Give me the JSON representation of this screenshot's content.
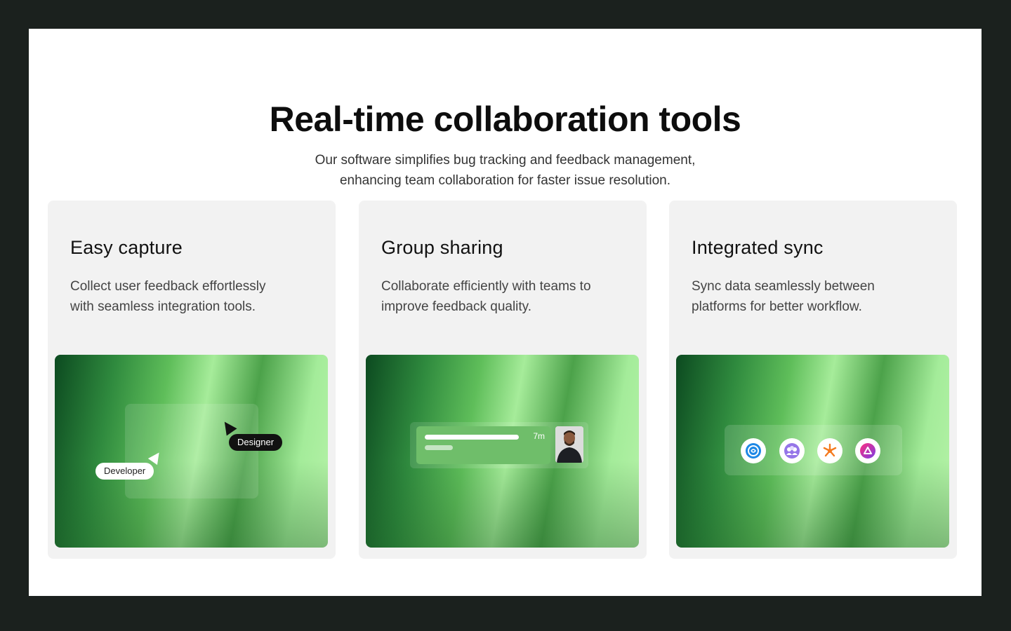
{
  "header": {
    "title": "Real-time collaboration tools",
    "subtitle_line1": "Our software simplifies bug tracking and feedback management,",
    "subtitle_line2": "enhancing team collaboration for faster issue resolution."
  },
  "cards": [
    {
      "title": "Easy capture",
      "desc_line1": "Collect user feedback effortlessly",
      "desc_line2": "with seamless integration tools.",
      "visual": {
        "designer_label": "Designer",
        "developer_label": "Developer"
      }
    },
    {
      "title": "Group sharing",
      "desc_line1": "Collaborate efficiently with teams to",
      "desc_line2": "improve feedback quality.",
      "visual": {
        "time_label": "7m"
      }
    },
    {
      "title": "Integrated sync",
      "desc_line1": "Sync data seamlessly between",
      "desc_line2": "platforms for better workflow.",
      "visual": {
        "apps": [
          "spiral-app-icon",
          "team-app-icon",
          "sun-app-icon",
          "cloud-app-icon"
        ]
      }
    }
  ],
  "colors": {
    "page_background": "#1b211e",
    "card_background": "#f2f2f2",
    "accent_green_dark": "#0c4a20",
    "accent_green_light": "#a6ec9a"
  }
}
